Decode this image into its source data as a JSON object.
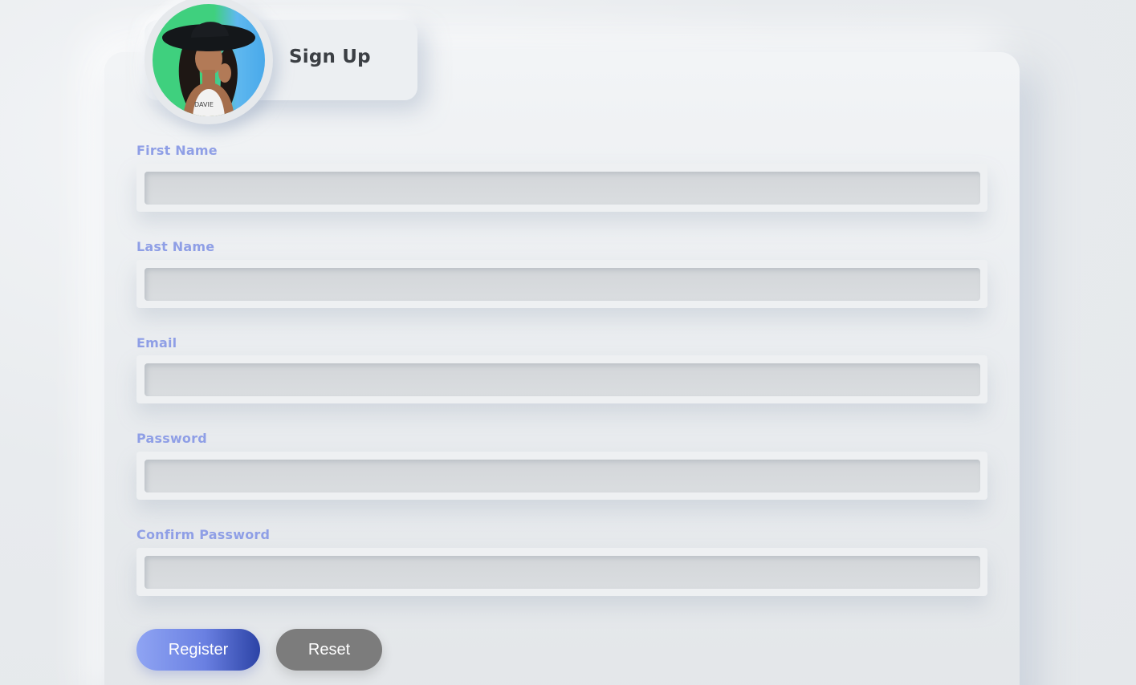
{
  "header": {
    "title": "Sign Up",
    "avatar_alt": "profile-photo"
  },
  "form": {
    "fields": [
      {
        "label": "First Name",
        "value": ""
      },
      {
        "label": "Last Name",
        "value": ""
      },
      {
        "label": "Email",
        "value": ""
      },
      {
        "label": "Password",
        "value": ""
      },
      {
        "label": "Confirm Password",
        "value": ""
      }
    ],
    "register_label": "Register",
    "reset_label": "Reset"
  },
  "colors": {
    "label": "#8f9fe6",
    "register_gradient_start": "#8fa4f3",
    "register_gradient_end": "#2c43a6",
    "reset": "#7c7c7c",
    "background": "#e8ebee"
  }
}
